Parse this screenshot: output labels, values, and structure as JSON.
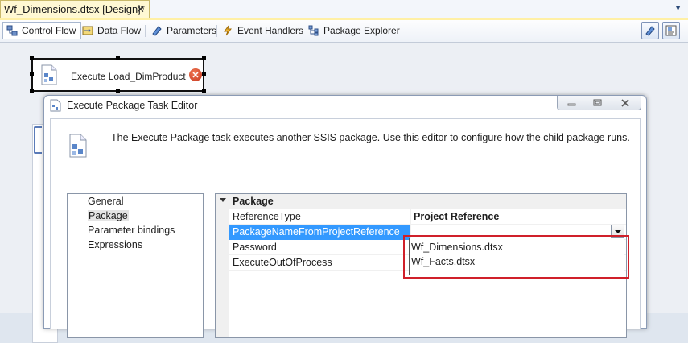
{
  "document_tab": {
    "title": "Wf_Dimensions.dtsx [Design]*",
    "close": "✕"
  },
  "designer_tabs": [
    {
      "label": "Control Flow"
    },
    {
      "label": "Data Flow"
    },
    {
      "label": "Parameters"
    },
    {
      "label": "Event Handlers"
    },
    {
      "label": "Package Explorer"
    }
  ],
  "task": {
    "label": "Execute Load_DimProduct",
    "error_glyph": "✕"
  },
  "dialog": {
    "title": "Execute Package Task Editor",
    "description": "The Execute Package task executes another SSIS package. Use this editor to configure how the child package runs.",
    "nav_items": [
      "General",
      "Package",
      "Parameter bindings",
      "Expressions"
    ],
    "grid": {
      "category": "Package",
      "rows": [
        {
          "name": "ReferenceType",
          "value": "Project Reference"
        },
        {
          "name": "PackageNameFromProjectReference",
          "value": ""
        },
        {
          "name": "Password",
          "value": ""
        },
        {
          "name": "ExecuteOutOfProcess",
          "value": ""
        }
      ],
      "dropdown_options": [
        "Wf_Dimensions.dtsx",
        "Wf_Facts.dtsx"
      ]
    }
  },
  "colors": {
    "selection": "#3399ff",
    "highlight_border": "#d0202a",
    "active_doc_tab": "#fff8d3"
  }
}
